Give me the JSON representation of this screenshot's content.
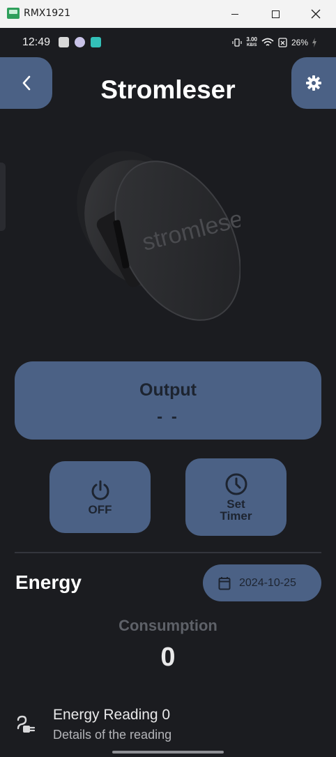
{
  "window": {
    "title": "RMX1921"
  },
  "status_bar": {
    "time": "12:49",
    "net_speed_value": "3.00",
    "net_speed_unit": "KB/S",
    "battery": "26%"
  },
  "header": {
    "title": "Stromleser"
  },
  "device": {
    "brand_text": "stromleser"
  },
  "output": {
    "label": "Output",
    "value": "- -"
  },
  "controls": {
    "power_label": "OFF",
    "timer_label_line1": "Set",
    "timer_label_line2": "Timer"
  },
  "energy": {
    "heading": "Energy",
    "date": "2024-10-25",
    "consumption_label": "Consumption",
    "consumption_value": "0"
  },
  "reading": {
    "title": "Energy Reading 0",
    "subtitle": "Details of the reading"
  },
  "colors": {
    "background": "#1b1c20",
    "accent": "#4b6185",
    "accent_text": "#1d2430"
  }
}
